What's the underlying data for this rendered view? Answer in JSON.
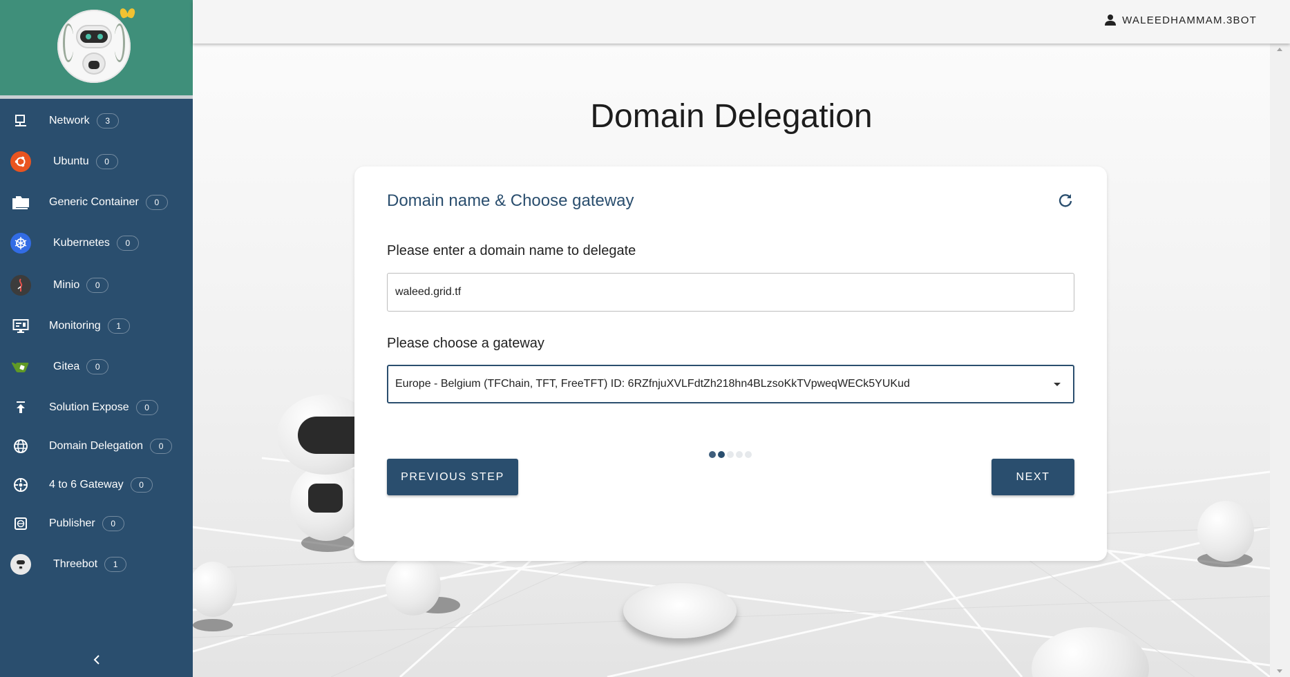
{
  "sidebar": {
    "items": [
      {
        "label": "Network",
        "count": "3",
        "icon": "network-icon"
      },
      {
        "label": "Ubuntu",
        "count": "0",
        "icon": "ubuntu-icon"
      },
      {
        "label": "Generic Container",
        "count": "0",
        "icon": "folder-icon"
      },
      {
        "label": "Kubernetes",
        "count": "0",
        "icon": "kubernetes-icon"
      },
      {
        "label": "Minio",
        "count": "0",
        "icon": "minio-icon"
      },
      {
        "label": "Monitoring",
        "count": "1",
        "icon": "monitor-icon"
      },
      {
        "label": "Gitea",
        "count": "0",
        "icon": "gitea-icon"
      },
      {
        "label": "Solution Expose",
        "count": "0",
        "icon": "upload-icon"
      },
      {
        "label": "Domain Delegation",
        "count": "0",
        "icon": "globe-icon"
      },
      {
        "label": "4 to 6 Gateway",
        "count": "0",
        "icon": "gateway-icon"
      },
      {
        "label": "Publisher",
        "count": "0",
        "icon": "web-icon"
      },
      {
        "label": "Threebot",
        "count": "1",
        "icon": "threebot-icon"
      }
    ]
  },
  "topbar": {
    "username": "WALEEDHAMMAM.3BOT"
  },
  "page": {
    "title": "Domain Delegation"
  },
  "card": {
    "title": "Domain name & Choose gateway",
    "domain_label": "Please enter a domain name to delegate",
    "domain_value": "waleed.grid.tf",
    "gateway_label": "Please choose a gateway",
    "gateway_value": "Europe - Belgium (TFChain, TFT, FreeTFT) ID: 6RZfnjuXVLFdtZh218hn4BLzsoKkTVpweqWECk5YUKud",
    "steps_total": 5,
    "current_step": 2,
    "prev_label": "PREVIOUS STEP",
    "next_label": "NEXT"
  },
  "colors": {
    "sidebar": "#2a4e6e",
    "sidebar_header": "#3f8f7a",
    "accent": "#2a4e6e"
  }
}
